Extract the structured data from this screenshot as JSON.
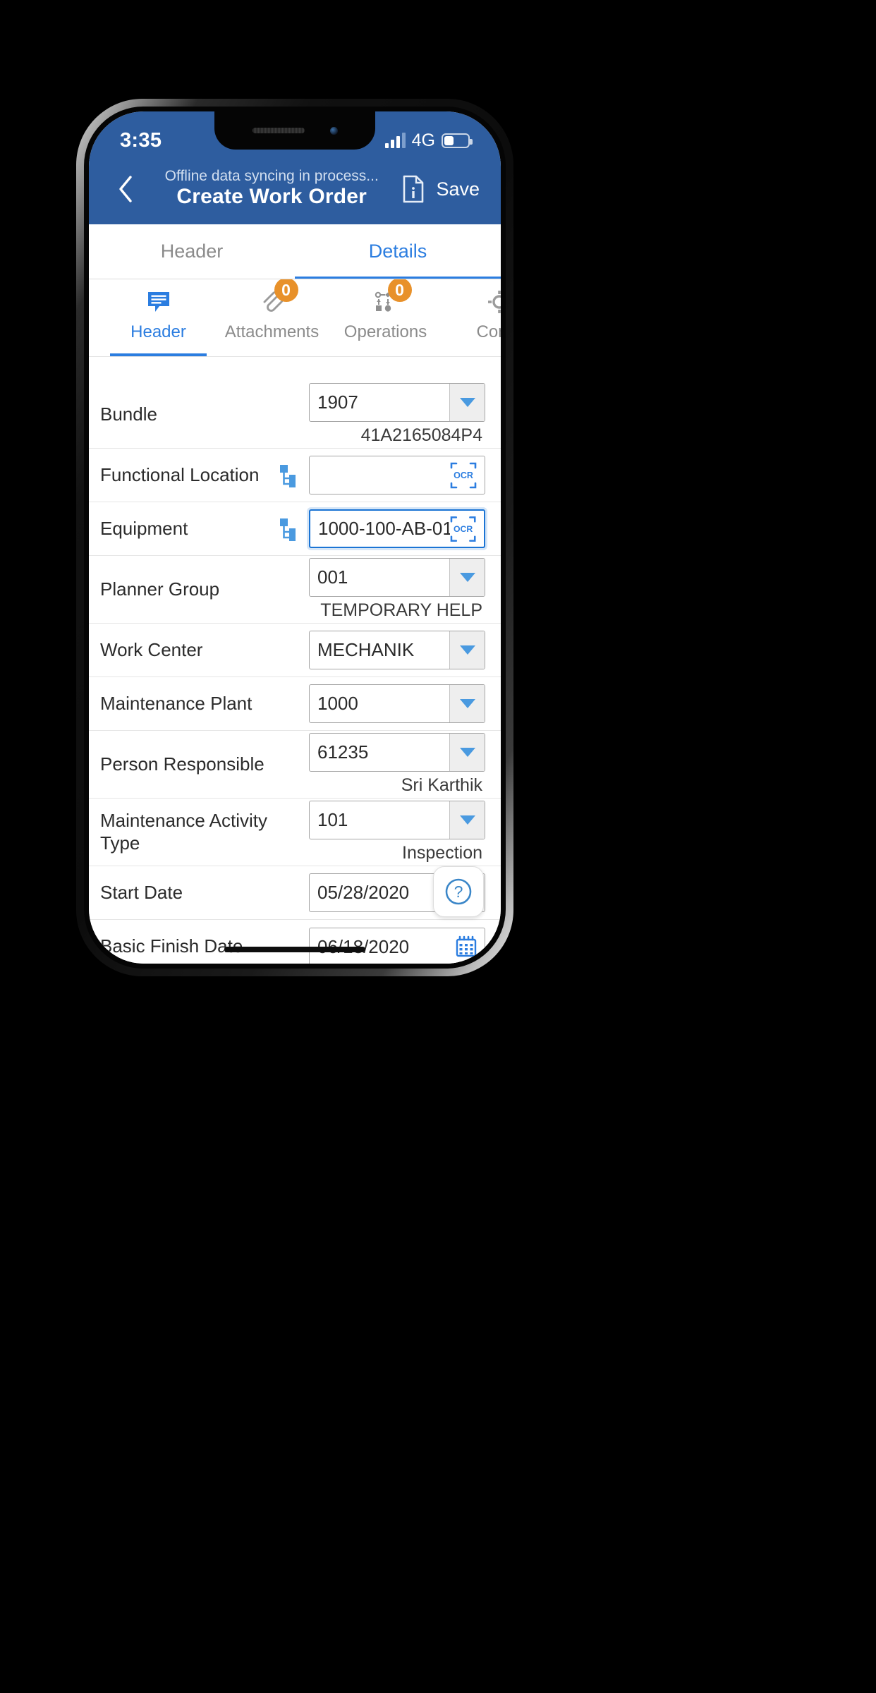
{
  "status_bar": {
    "time": "3:35",
    "network": "4G",
    "signal_icon": "signal-bars-icon",
    "battery_icon": "battery-icon"
  },
  "nav_bar": {
    "back_icon": "chevron-left-icon",
    "sync_status": "Offline data syncing in process...",
    "title": "Create Work Order",
    "info_icon": "document-info-icon",
    "save_label": "Save"
  },
  "main_tabs": [
    {
      "label": "Header",
      "active": false
    },
    {
      "label": "Details",
      "active": true
    }
  ],
  "icon_tabs": [
    {
      "label": "Header",
      "icon": "speech-bubble-lines-icon",
      "badge": null,
      "active": true
    },
    {
      "label": "Attachments",
      "icon": "paperclip-icon",
      "badge": "0",
      "active": false
    },
    {
      "label": "Operations",
      "icon": "process-flow-icon",
      "badge": "0",
      "active": false
    },
    {
      "label": "Comp",
      "icon": "gear-icon",
      "badge": null,
      "active": false
    }
  ],
  "form_fields": [
    {
      "label": "Bundle",
      "type": "combo",
      "value": "1907",
      "sub_value": "41A2165084P4",
      "hierarchy_icon": false
    },
    {
      "label": "Functional Location",
      "type": "ocr",
      "value": "",
      "sub_value": "",
      "hierarchy_icon": true,
      "ocr_label": "OCR",
      "focused": false
    },
    {
      "label": "Equipment",
      "type": "ocr",
      "value": "1000-100-AB-01",
      "sub_value": "",
      "hierarchy_icon": true,
      "ocr_label": "OCR",
      "focused": true
    },
    {
      "label": "Planner Group",
      "type": "combo",
      "value": "001",
      "sub_value": "TEMPORARY HELP",
      "hierarchy_icon": false
    },
    {
      "label": "Work Center",
      "type": "combo",
      "value": "MECHANIK",
      "sub_value": "",
      "hierarchy_icon": false
    },
    {
      "label": "Maintenance Plant",
      "type": "combo",
      "value": "1000",
      "sub_value": "",
      "hierarchy_icon": false
    },
    {
      "label": "Person Responsible",
      "type": "combo",
      "value": "61235",
      "sub_value": "Sri Karthik",
      "hierarchy_icon": false
    },
    {
      "label": "Maintenance Activity Type",
      "type": "combo",
      "value": "101",
      "sub_value": "Inspection",
      "hierarchy_icon": false
    },
    {
      "label": "Start Date",
      "type": "date",
      "value": "05/28/2020",
      "sub_value": "",
      "hierarchy_icon": false
    },
    {
      "label": "Basic Finish Date",
      "type": "date",
      "value": "06/18/2020",
      "sub_value": "",
      "hierarchy_icon": false
    }
  ],
  "help_button": {
    "icon": "question-mark-circle-icon",
    "label": "?"
  },
  "colors": {
    "brand_blue": "#2e5d9f",
    "accent_blue": "#2b7de0",
    "badge_orange": "#e8912a",
    "focus_blue": "#1b74d4"
  }
}
